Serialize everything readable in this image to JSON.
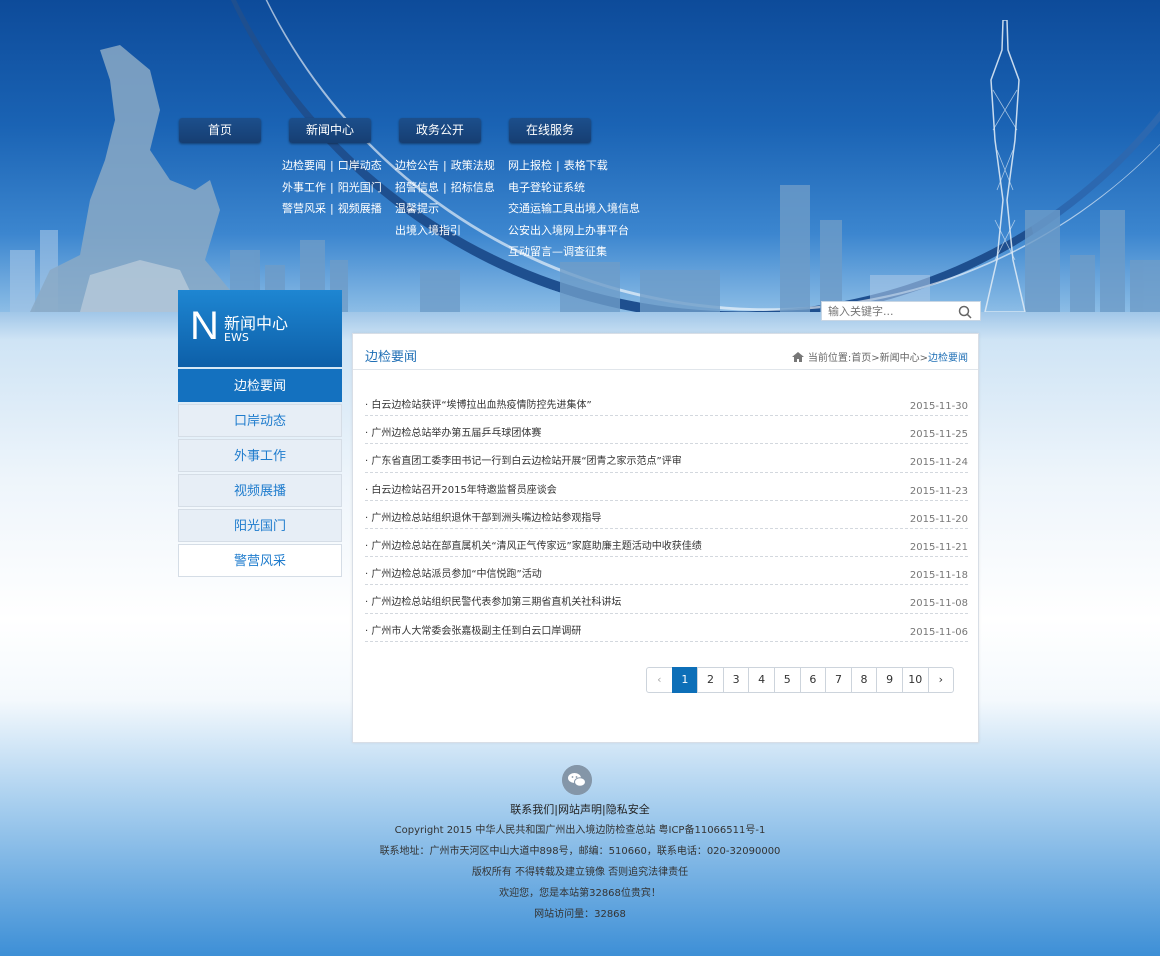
{
  "nav": [
    {
      "label": "首页"
    },
    {
      "label": "新闻中心"
    },
    {
      "label": "政务公开"
    },
    {
      "label": "在线服务"
    }
  ],
  "submenus": {
    "news": [
      [
        "边检要闻",
        "口岸动态"
      ],
      [
        "外事工作",
        "阳光国门"
      ],
      [
        "警营风采",
        "视频展播"
      ]
    ],
    "gov": [
      [
        "边检公告",
        "政策法规"
      ],
      [
        "招警信息",
        "招标信息"
      ],
      [
        "温馨提示"
      ],
      [
        "出境入境指引"
      ]
    ],
    "service": [
      [
        "网上报检",
        "表格下载"
      ],
      [
        "电子登轮证系统"
      ],
      [
        "交通运输工具出境入境信息"
      ],
      [
        "公安出入境网上办事平台"
      ],
      [
        "互动留言—调查征集"
      ]
    ]
  },
  "search": {
    "placeholder": "输入关键字..."
  },
  "side": {
    "letter": "N",
    "title": "新闻中心",
    "subtitle": "EWS",
    "items": [
      "边检要闻",
      "口岸动态",
      "外事工作",
      "视频展播",
      "阳光国门",
      "警营风采"
    ]
  },
  "panel": {
    "title": "边检要闻",
    "crumb_prefix": "当前位置:",
    "crumb_home": "首页",
    "crumb_sep": ">",
    "crumb_mid": "新闻中心",
    "crumb_here": "边检要闻"
  },
  "news": [
    {
      "title": "· 白云边检站获评“埃博拉出血热疫情防控先进集体”",
      "date": "2015-11-30"
    },
    {
      "title": "· 广州边检总站举办第五届乒乓球团体赛",
      "date": "2015-11-25"
    },
    {
      "title": "· 广东省直团工委李田书记一行到白云边检站开展“团青之家示范点”评审",
      "date": "2015-11-24"
    },
    {
      "title": "· 白云边检站召开2015年特邀监督员座谈会",
      "date": "2015-11-23"
    },
    {
      "title": "· 广州边检总站组织退休干部到洲头嘴边检站参观指导",
      "date": "2015-11-20"
    },
    {
      "title": "· 广州边检总站在部直属机关“清风正气传家远”家庭助廉主题活动中收获佳绩",
      "date": "2015-11-21"
    },
    {
      "title": "· 广州边检总站派员参加“中信悦跑”活动",
      "date": "2015-11-18"
    },
    {
      "title": "· 广州边检总站组织民警代表参加第三期省直机关社科讲坛",
      "date": "2015-11-08"
    },
    {
      "title": "· 广州市人大常委会张嘉极副主任到白云口岸调研",
      "date": "2015-11-06"
    }
  ],
  "pager": {
    "prev": "‹",
    "pages": [
      "1",
      "2",
      "3",
      "4",
      "5",
      "6",
      "7",
      "8",
      "9",
      "10"
    ],
    "next": "›",
    "current": "1"
  },
  "footer": {
    "links": "联系我们|网站声明|隐私安全",
    "copyright": "Copyright 2015   中华人民共和国广州出入境边防检查总站    粤ICP备11066511号-1",
    "address": "联系地址：广州市天河区中山大道中898号，邮编：510660，联系电话：020-32090000",
    "rights": "版权所有 不得转载及建立镜像 否则追究法律责任",
    "welcome": "欢迎您，您是本站第32868位贵宾！",
    "visits": "网站访问量：32868"
  },
  "colors": {
    "accent": "#1471bf",
    "header": "#1a63b4"
  },
  "icons": {
    "search": "search-icon",
    "home": "home-icon",
    "wechat": "wechat-icon"
  }
}
